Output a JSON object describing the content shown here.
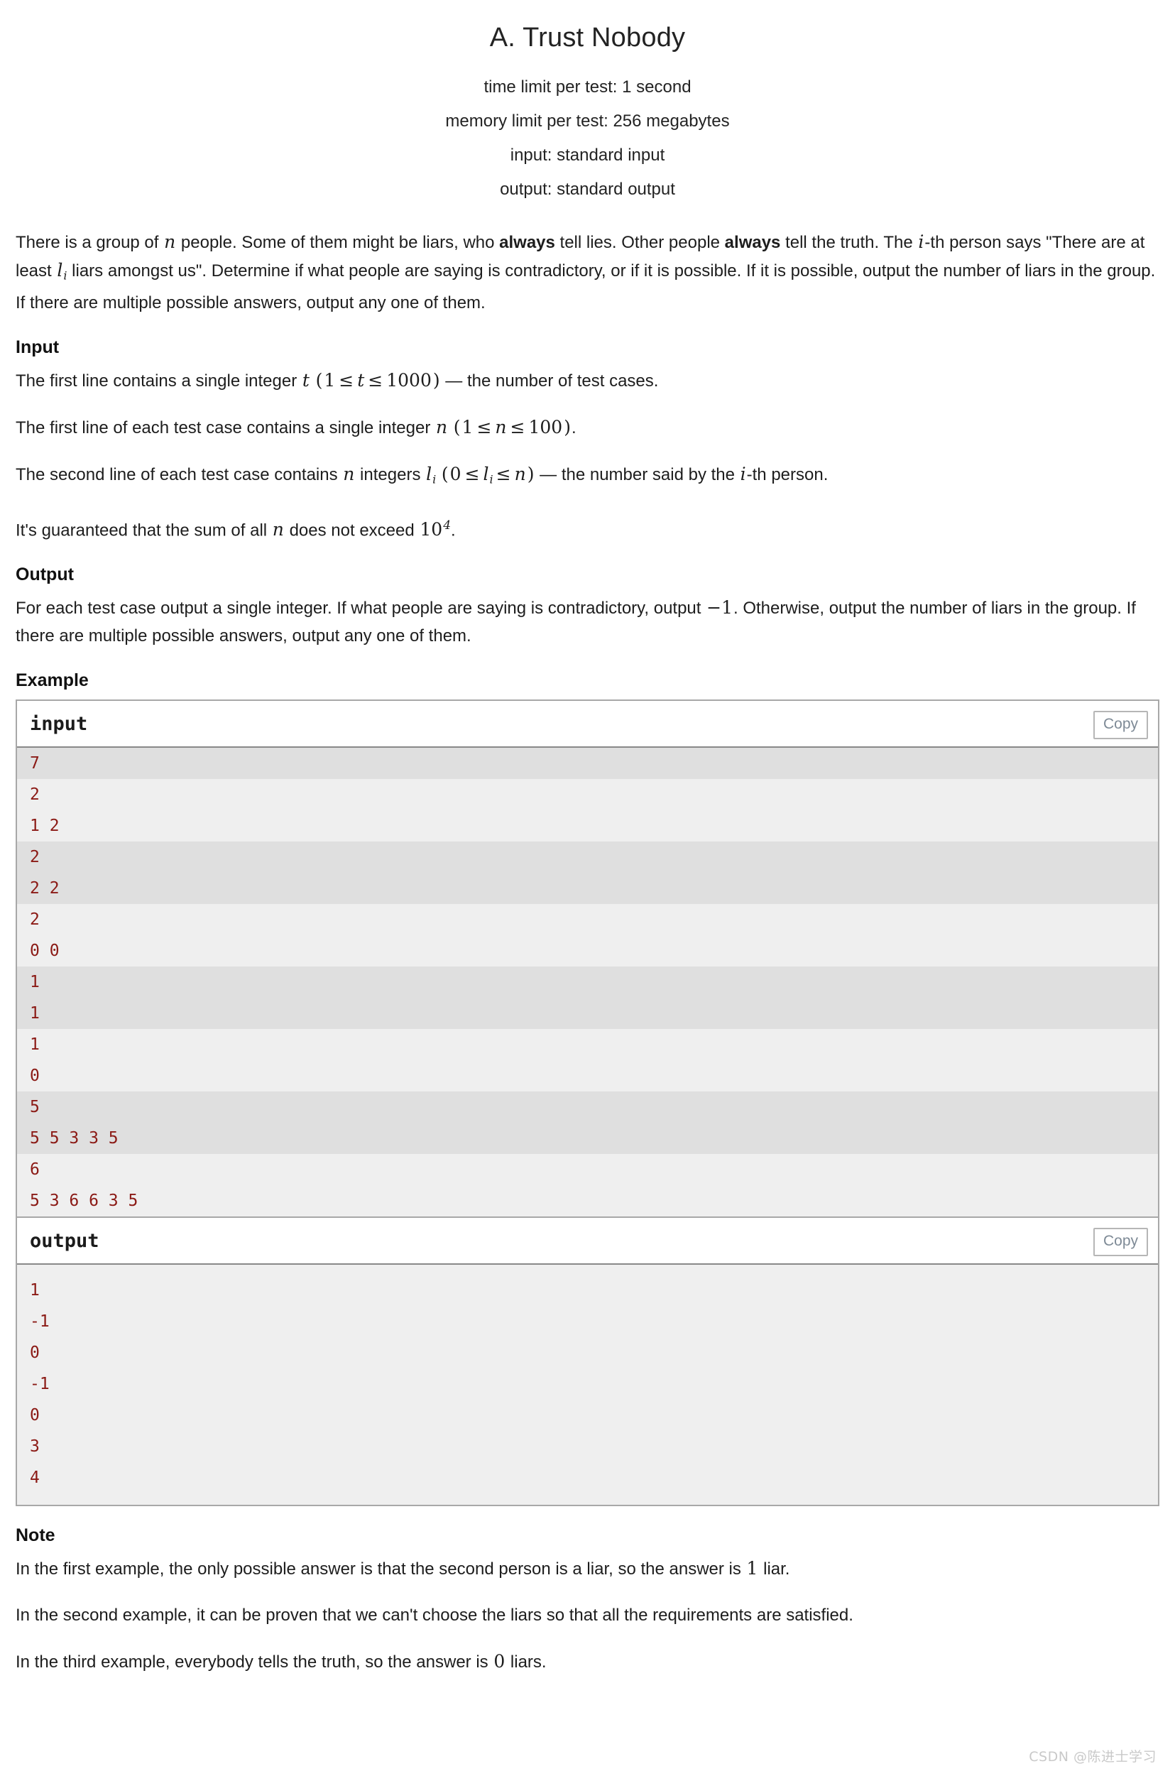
{
  "header": {
    "title": "A. Trust Nobody",
    "limits": [
      "time limit per test: 1 second",
      "memory limit per test: 256 megabytes",
      "input: standard input",
      "output: standard output"
    ]
  },
  "statement": {
    "p1_a": "There is a group of ",
    "p1_n": "n",
    "p1_b": " people. Some of them might be liars, who ",
    "p1_always1": "always",
    "p1_c": " tell lies. Other people ",
    "p1_always2": "always",
    "p1_d": " tell the truth. The ",
    "p1_i": "i",
    "p1_e": "-th person says \"There are at least ",
    "p1_l": "l",
    "p1_lsub": "i",
    "p1_f": " liars amongst us\". Determine if what people are saying is contradictory, or if it is possible. If it is possible, output the number of liars in the group. If there are multiple possible answers, output any one of them."
  },
  "input_section": {
    "heading": "Input",
    "para1": {
      "a": "The first line contains a single integer ",
      "t": "t",
      "open": "(",
      "one": "1",
      "le1": "≤",
      "t2": "t",
      "le2": "≤",
      "thousand": "1000",
      "close": ")",
      "dash": " — the number of test cases."
    },
    "para2": {
      "a": "The first line of each test case contains a single integer ",
      "n": "n",
      "open": "(",
      "one": "1",
      "le1": "≤",
      "n2": "n",
      "le2": "≤",
      "hundred": "100",
      "close": ")",
      "end": "."
    },
    "para3": {
      "a": "The second line of each test case contains ",
      "n": "n",
      "b": " integers ",
      "l": "l",
      "lsub": "i",
      "open": "(",
      "zero": "0",
      "le1": "≤",
      "l2": "l",
      "l2sub": "i",
      "le2": "≤",
      "n2": "n",
      "close": ")",
      "dash": " — the number said by the ",
      "i": "i",
      "end": "-th person."
    },
    "para4": {
      "a": "It's guaranteed that the sum of all ",
      "n": "n",
      "b": " does not exceed ",
      "ten": "10",
      "exp": "4",
      "end": "."
    }
  },
  "output_section": {
    "heading": "Output",
    "para_a": "For each test case output a single integer. If what people are saying is contradictory, output ",
    "minus_one": "−1",
    "para_b": ". Otherwise, output the number of liars in the group. If there are multiple possible answers, output any one of them."
  },
  "example": {
    "heading": "Example",
    "input_label": "input",
    "output_label": "output",
    "copy_label": "Copy",
    "input_lines": [
      "7",
      "2",
      "1 2",
      "2",
      "2 2",
      "2",
      "0 0",
      "1",
      "1",
      "1",
      "0",
      "5",
      "5 5 3 3 5",
      "6",
      "5 3 6 6 3 5"
    ],
    "input_stripes": [
      true,
      false,
      false,
      true,
      true,
      false,
      false,
      true,
      true,
      false,
      false,
      true,
      true,
      false,
      false
    ],
    "output_lines": [
      "1",
      "-1",
      "0",
      "-1",
      "0",
      "3",
      "4"
    ]
  },
  "note_section": {
    "heading": "Note",
    "n1_a": "In the first example, the only possible answer is that the second person is a liar, so the answer is ",
    "n1_num": "1",
    "n1_b": " liar.",
    "n2": "In the second example, it can be proven that we can't choose the liars so that all the requirements are satisfied.",
    "n3_a": "In the third example, everybody tells the truth, so the answer is ",
    "n3_num": "0",
    "n3_b": " liars."
  },
  "watermark": "CSDN @陈进士学习",
  "colors": {
    "code_text": "#8b1a15",
    "stripe": "#dfdfdf",
    "code_bg": "#efefef",
    "border": "#a8a8a8"
  }
}
